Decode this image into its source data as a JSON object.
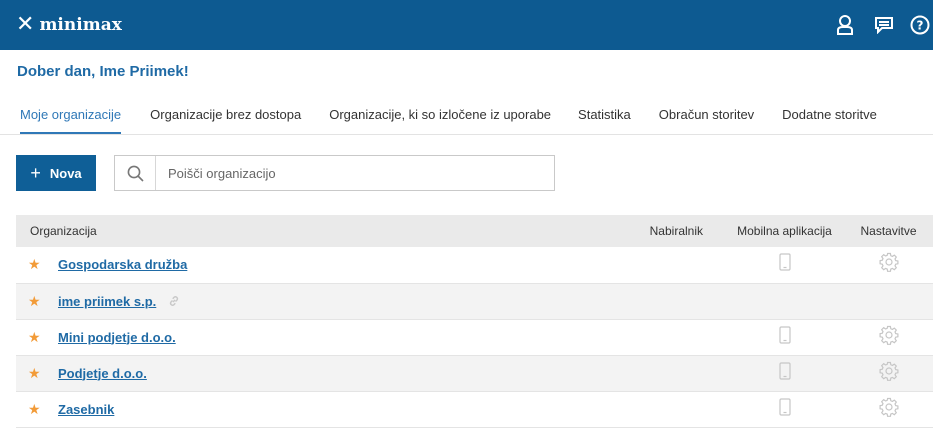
{
  "app": {
    "name": "minimax"
  },
  "greeting": "Dober dan,  Ime Priimek!",
  "tabs": [
    {
      "label": "Moje organizacije",
      "active": true
    },
    {
      "label": "Organizacije brez dostopa",
      "active": false
    },
    {
      "label": "Organizacije, ki so izločene iz uporabe",
      "active": false
    },
    {
      "label": "Statistika",
      "active": false
    },
    {
      "label": "Obračun storitev",
      "active": false
    },
    {
      "label": "Dodatne storitve",
      "active": false
    }
  ],
  "toolbar": {
    "new_plus": "+",
    "new_label": "Nova",
    "search_placeholder": "Poišči organizacijo",
    "search_value": ""
  },
  "table": {
    "columns": [
      "Organizacija",
      "Nabiralnik",
      "Mobilna aplikacija",
      "Nastavitve"
    ],
    "rows": [
      {
        "name": "Gospodarska družba",
        "favorite": true,
        "linked": false,
        "mobile": true,
        "settings": true
      },
      {
        "name": "ime priimek s.p.",
        "favorite": true,
        "linked": true,
        "mobile": false,
        "settings": false
      },
      {
        "name": "Mini podjetje d.o.o.",
        "favorite": true,
        "linked": false,
        "mobile": true,
        "settings": true
      },
      {
        "name": "Podjetje d.o.o.",
        "favorite": true,
        "linked": false,
        "mobile": true,
        "settings": true
      },
      {
        "name": "Zasebnik",
        "favorite": true,
        "linked": false,
        "mobile": true,
        "settings": true
      }
    ]
  },
  "icons": {
    "logo": "minimax-x-icon",
    "user": "user-icon",
    "messages": "messages-icon",
    "help": "help-icon",
    "search": "search-icon",
    "star": "star-icon",
    "link": "link-icon",
    "mobile": "mobile-phone-icon",
    "settings": "gear-icon"
  },
  "colors": {
    "topbar": "#0d5a91",
    "primary": "#0f5f97",
    "link": "#1f6aa5",
    "star": "#f29b38"
  }
}
